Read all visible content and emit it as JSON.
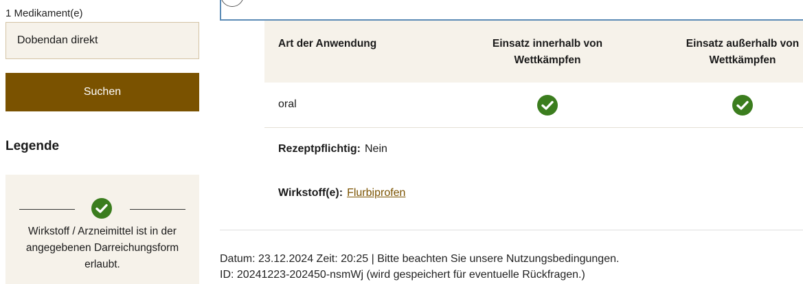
{
  "search": {
    "label": "1 Medikament(e)",
    "value": "Dobendan direkt",
    "button": "Suchen"
  },
  "legend": {
    "title": "Legende",
    "allowed_text": "Wirkstoff / Arzneimittel ist in der angegebenen Darreichungsform erlaubt.",
    "icon": "check-circle-icon",
    "icon_color": "#3b7d1e"
  },
  "table": {
    "headers": [
      "Art der Anwendung",
      "Einsatz innerhalb von Wettkämpfen",
      "Einsatz außerhalb von Wettkämpfen"
    ],
    "rows": [
      {
        "application": "oral",
        "in_competition": "allowed",
        "out_of_competition": "allowed"
      }
    ]
  },
  "details": {
    "prescription_label": "Rezeptpflichtig:",
    "prescription_value": "Nein",
    "substance_label": "Wirkstoff(e):",
    "substance_value": "Flurbiprofen"
  },
  "footer": {
    "line1": "Datum: 23.12.2024 Zeit: 20:25 | Bitte beachten Sie unsere Nutzungsbedingungen.",
    "line2": "ID: 20241223-202450-nsmWj (wird gespeichert für eventuelle Rückfragen.)"
  },
  "colors": {
    "accent": "#7a5200",
    "panel_bg": "#f6f2ea",
    "check": "#3b7d1e",
    "accordion_border": "#5b8bb5"
  }
}
